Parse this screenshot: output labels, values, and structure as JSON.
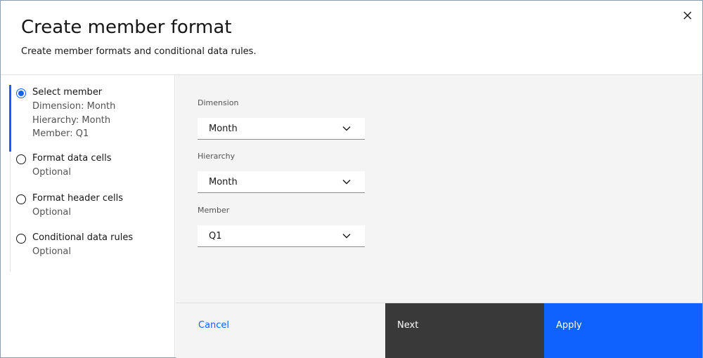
{
  "header": {
    "title": "Create member format",
    "subtitle": "Create member formats and conditional data rules."
  },
  "steps": [
    {
      "label": "Select member",
      "details": [
        "Dimension: Month",
        "Hierarchy: Month",
        "Member: Q1"
      ],
      "state": "active"
    },
    {
      "label": "Format data cells",
      "details": [
        "Optional"
      ],
      "state": "inactive"
    },
    {
      "label": "Format header cells",
      "details": [
        "Optional"
      ],
      "state": "inactive"
    },
    {
      "label": "Conditional data rules",
      "details": [
        "Optional"
      ],
      "state": "inactive"
    }
  ],
  "form": {
    "dimension": {
      "label": "Dimension",
      "value": "Month"
    },
    "hierarchy": {
      "label": "Hierarchy",
      "value": "Month"
    },
    "member": {
      "label": "Member",
      "value": "Q1"
    }
  },
  "footer": {
    "cancel_label": "Cancel",
    "next_label": "Next",
    "apply_label": "Apply"
  },
  "colors": {
    "accent": "#0f62fe",
    "secondary_button": "#393939",
    "panel_bg": "#f4f4f4"
  }
}
